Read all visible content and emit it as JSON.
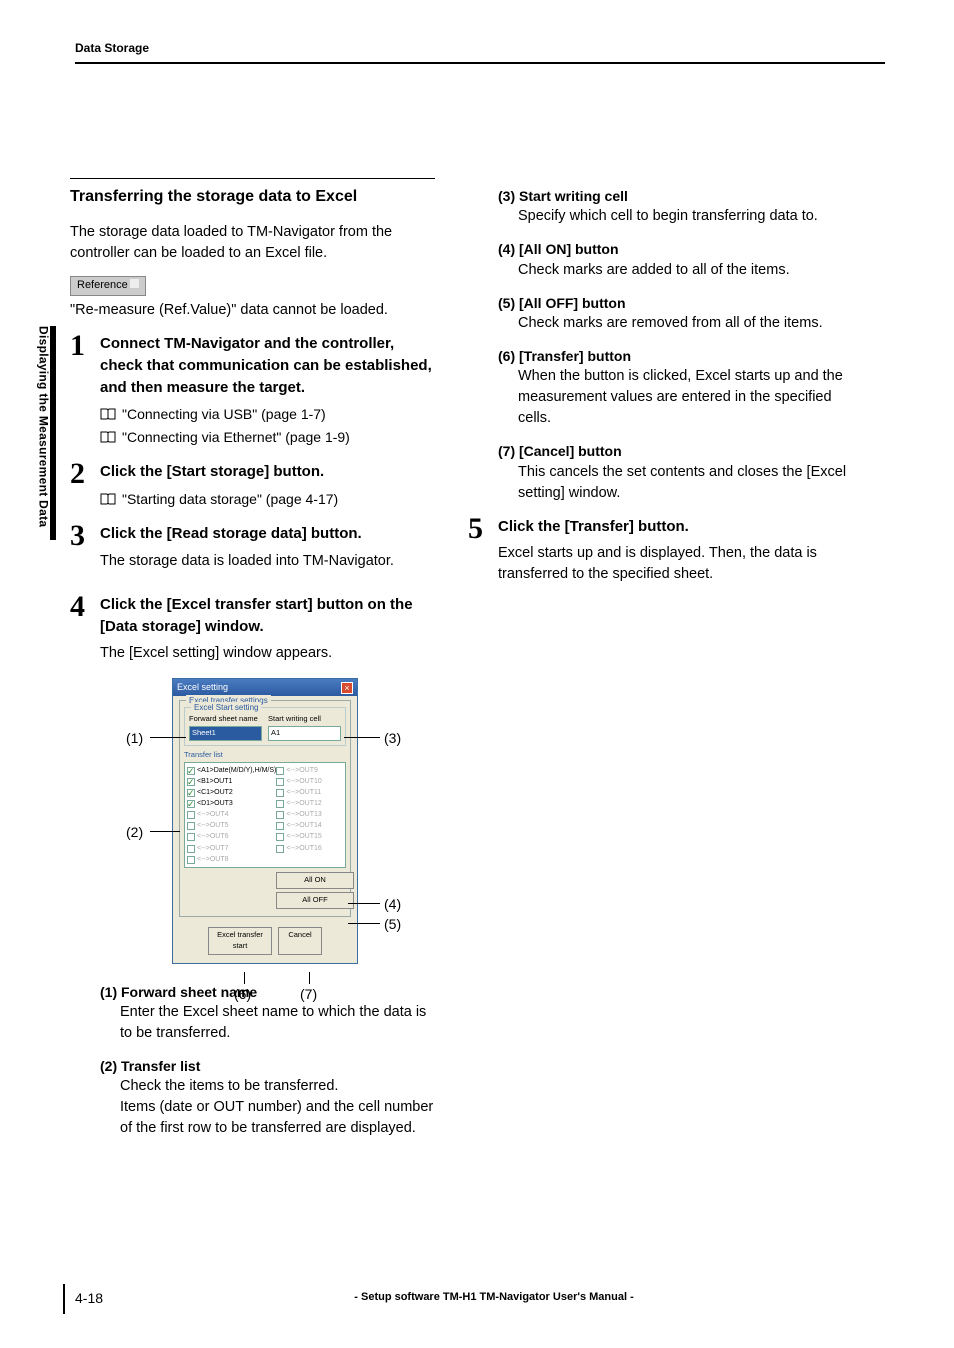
{
  "header": {
    "section": "Data Storage"
  },
  "sideTab": "Displaying the Measurement Data",
  "section": {
    "title": "Transferring the storage data to Excel",
    "intro": "The storage data loaded to TM-Navigator from the controller can be loaded to an Excel file.",
    "refBadge": "Reference",
    "refNote": "\"Re-measure (Ref.Value)\" data cannot be loaded."
  },
  "steps": {
    "s1": {
      "num": "1",
      "title": "Connect TM-Navigator and the controller, check that communication can be established, and then measure the target.",
      "xref1": "\"Connecting via USB\" (page 1-7)",
      "xref2": "\"Connecting via Ethernet\" (page 1-9)"
    },
    "s2": {
      "num": "2",
      "title": "Click the [Start storage] button.",
      "xref1": "\"Starting data storage\" (page 4-17)"
    },
    "s3": {
      "num": "3",
      "title": "Click the [Read storage data] button.",
      "body": "The storage data is loaded into TM-Navigator."
    },
    "s4": {
      "num": "4",
      "title": "Click the [Excel transfer start] button on the [Data storage] window.",
      "body": "The [Excel setting] window appears."
    },
    "s5": {
      "num": "5",
      "title": "Click the [Transfer] button.",
      "body": "Excel starts up and is displayed. Then, the data is transferred to the specified sheet."
    }
  },
  "dialog": {
    "title": "Excel setting",
    "group1": "Excel transfer settings",
    "group2": "Excel Start setting",
    "fwdLabel": "Forward sheet name",
    "fwdVal": "Sheet1",
    "startLabel": "Start writing cell",
    "startVal": "A1",
    "tlistLabel": "Transfer list",
    "left": [
      {
        "c": true,
        "t": "<A1>Date(M/D/Y),H/M/S)"
      },
      {
        "c": true,
        "t": "<B1>OUT1"
      },
      {
        "c": true,
        "t": "<C1>OUT2"
      },
      {
        "c": true,
        "t": "<D1>OUT3"
      },
      {
        "c": false,
        "t": "<-->OUT4"
      },
      {
        "c": false,
        "t": "<-->OUT5"
      },
      {
        "c": false,
        "t": "<-->OUT6"
      },
      {
        "c": false,
        "t": "<-->OUT7"
      },
      {
        "c": false,
        "t": "<-->OUT8"
      }
    ],
    "right": [
      {
        "c": false,
        "t": "<-->OUT9"
      },
      {
        "c": false,
        "t": "<-->OUT10"
      },
      {
        "c": false,
        "t": "<-->OUT11"
      },
      {
        "c": false,
        "t": "<-->OUT12"
      },
      {
        "c": false,
        "t": "<-->OUT13"
      },
      {
        "c": false,
        "t": "<-->OUT14"
      },
      {
        "c": false,
        "t": "<-->OUT15"
      },
      {
        "c": false,
        "t": "<-->OUT16"
      }
    ],
    "allOn": "All ON",
    "allOff": "All OFF",
    "transfer": "Excel transfer start",
    "cancel": "Cancel"
  },
  "callouts": {
    "c1": "(1)",
    "c2": "(2)",
    "c3": "(3)",
    "c4": "(4)",
    "c5": "(5)",
    "c6": "(6)",
    "c7": "(7)"
  },
  "annotations": {
    "a1": {
      "label": "(1) Forward sheet name",
      "body": "Enter the Excel sheet name to which the data is to be transferred."
    },
    "a2": {
      "label": "(2) Transfer list",
      "body1": "Check the items to be transferred.",
      "body2": "Items (date or OUT number) and the cell number of the first row to be transferred are displayed."
    },
    "a3": {
      "label": "(3) Start writing cell",
      "body": "Specify which cell to begin transferring data to."
    },
    "a4": {
      "label": "(4) [All ON] button",
      "body": "Check marks are added to all of the items."
    },
    "a5": {
      "label": "(5) [All OFF] button",
      "body": "Check marks are removed from all of the items."
    },
    "a6": {
      "label": "(6) [Transfer] button",
      "body": "When the button is clicked, Excel starts up and the measurement values are entered in the specified cells."
    },
    "a7": {
      "label": "(7) [Cancel] button",
      "body": "This cancels the set contents and closes the [Excel setting] window."
    }
  },
  "footer": {
    "pageNum": "4-18",
    "title": "- Setup software TM-H1 TM-Navigator User's Manual -"
  }
}
